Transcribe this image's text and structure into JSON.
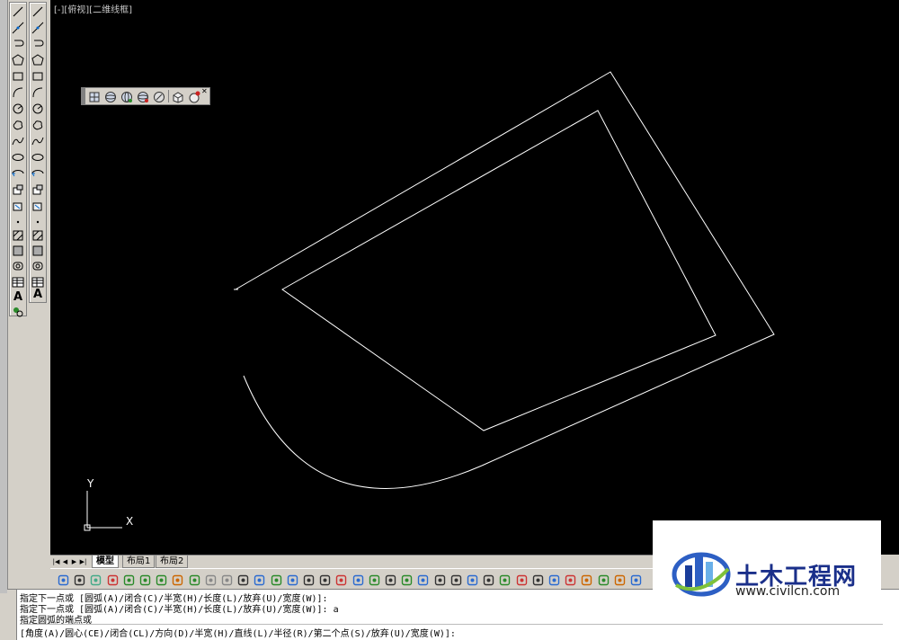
{
  "viewport": {
    "label": "[-][俯视][二维线框]"
  },
  "layout_tabs": [
    "模型",
    "布局1",
    "布局2"
  ],
  "command_lines": [
    "指定下一点或 [圆弧(A)/闭合(C)/半宽(H)/长度(L)/放弃(U)/宽度(W)]:",
    "指定下一点或 [圆弧(A)/闭合(C)/半宽(H)/长度(L)/放弃(U)/宽度(W)]: a",
    "指定圆弧的端点或",
    "[角度(A)/圆心(CE)/闭合(CL)/方向(D)/半宽(H)/直线(L)/半径(R)/第二个点(S)/放弃(U)/宽度(W)]:"
  ],
  "ucs": {
    "y_label": "Y",
    "x_label": "X"
  },
  "watermark": {
    "title": "土木工程网",
    "url": "www.civilcn.com"
  },
  "draw_toolbar_icons": [
    "line-icon",
    "construction-line-icon",
    "polyline-icon",
    "polygon-icon",
    "rectangle-icon",
    "arc-icon",
    "circle-icon",
    "revision-cloud-icon",
    "spline-icon",
    "ellipse-icon",
    "ellipse-arc-icon",
    "insert-block-icon",
    "make-block-icon",
    "point-icon",
    "hatch-icon",
    "gradient-icon",
    "region-icon",
    "table-icon",
    "multiline-text-icon"
  ],
  "view_toolbar_icons": [
    "3d-orbit-icon",
    "free-orbit-icon",
    "continuous-orbit-icon",
    "adjust-distance-icon",
    "swivel-icon",
    "walk-icon",
    "fly-icon"
  ],
  "colors": {
    "canvas": "#000000",
    "geometry": "#ffffff",
    "ui": "#d4d0c8"
  }
}
